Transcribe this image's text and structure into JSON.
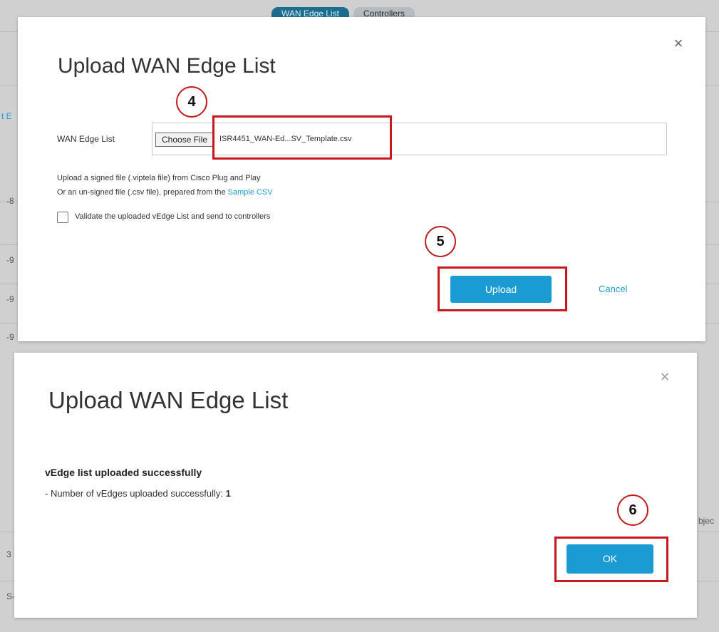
{
  "background": {
    "tabs": [
      "WAN Edge List",
      "Controllers"
    ],
    "fragments": [
      "t E",
      "-8",
      "-9",
      "-9",
      "-9",
      "bjec",
      "3",
      "S-"
    ]
  },
  "dialog1": {
    "title": "Upload WAN Edge List",
    "close_glyph": "×",
    "field_label": "WAN Edge List",
    "choose_file_label": "Choose File",
    "file_name": "ISR4451_WAN-Ed...SV_Template.csv",
    "help_line1": "Upload a signed file (.viptela file) from Cisco Plug and Play",
    "help_line2_prefix": "Or an un-signed file (.csv file), prepared from the ",
    "help_line2_link": "Sample CSV",
    "checkbox_label": "Validate the uploaded vEdge List and send to controllers",
    "checkbox_checked": false,
    "upload_label": "Upload",
    "cancel_label": "Cancel"
  },
  "dialog2": {
    "title": "Upload WAN Edge List",
    "close_glyph": "×",
    "success_heading": "vEdge list uploaded successfully",
    "count_prefix": "- Number of vEdges uploaded successfully: ",
    "count_value": "1",
    "ok_label": "OK"
  },
  "annotations": {
    "step4": "4",
    "step5": "5",
    "step6": "6"
  },
  "colors": {
    "accent": "#1a9bd1",
    "annotation": "#c8181e",
    "active_tab": "#1c6d8e"
  }
}
